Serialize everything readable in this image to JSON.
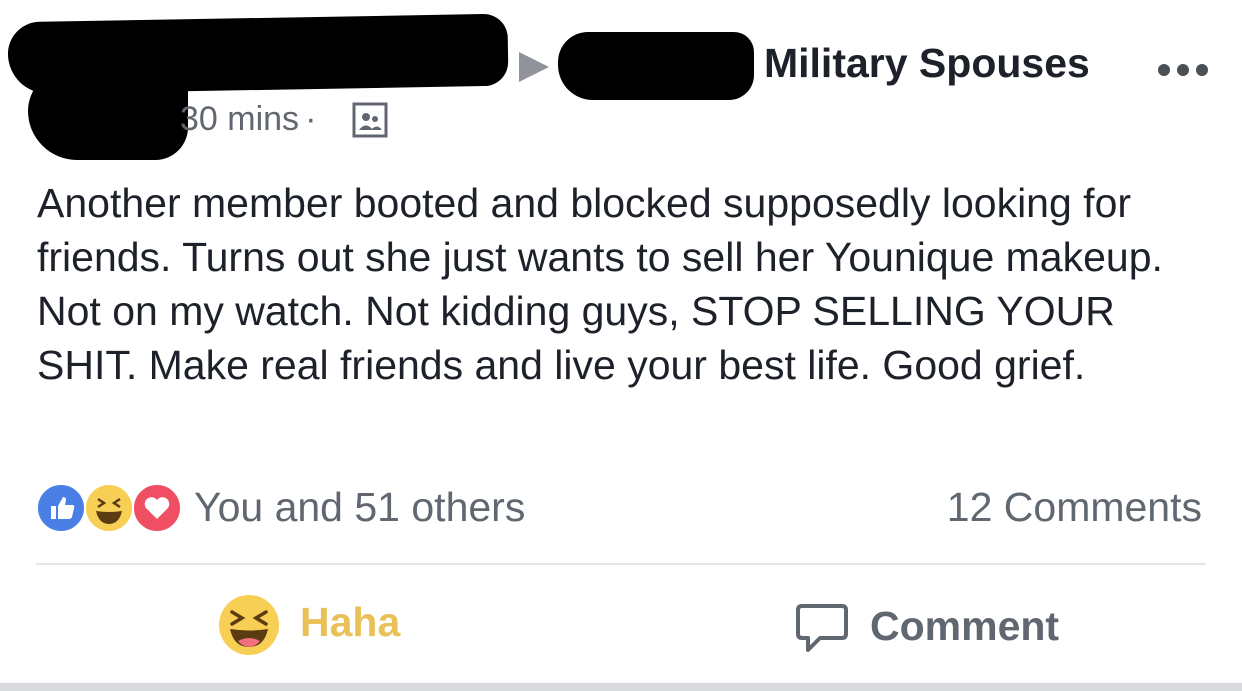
{
  "header": {
    "group_name": "Military Spouses",
    "timestamp": "30 mins",
    "separator": "·",
    "audience_icon": "group-audience-icon",
    "more_icon": "more-options-icon"
  },
  "post": {
    "text": "Another member booted and blocked supposedly looking for friends. Turns out she just wants to sell her Younique makeup. Not on my watch. Not kidding guys, STOP SELLING YOUR SHIT. Make real friends and live your best life. Good grief."
  },
  "reactions": {
    "icons": [
      "like-icon",
      "haha-icon",
      "love-icon"
    ],
    "summary": "You and 51 others",
    "comments": "12 Comments"
  },
  "actions": {
    "haha_label": "Haha",
    "comment_label": "Comment"
  },
  "colors": {
    "like_blue": "#4a7fe6",
    "haha_yellow": "#f7cf55",
    "haha_text": "#e9c156",
    "love_red": "#ef4e63",
    "secondary_text": "#606770"
  }
}
